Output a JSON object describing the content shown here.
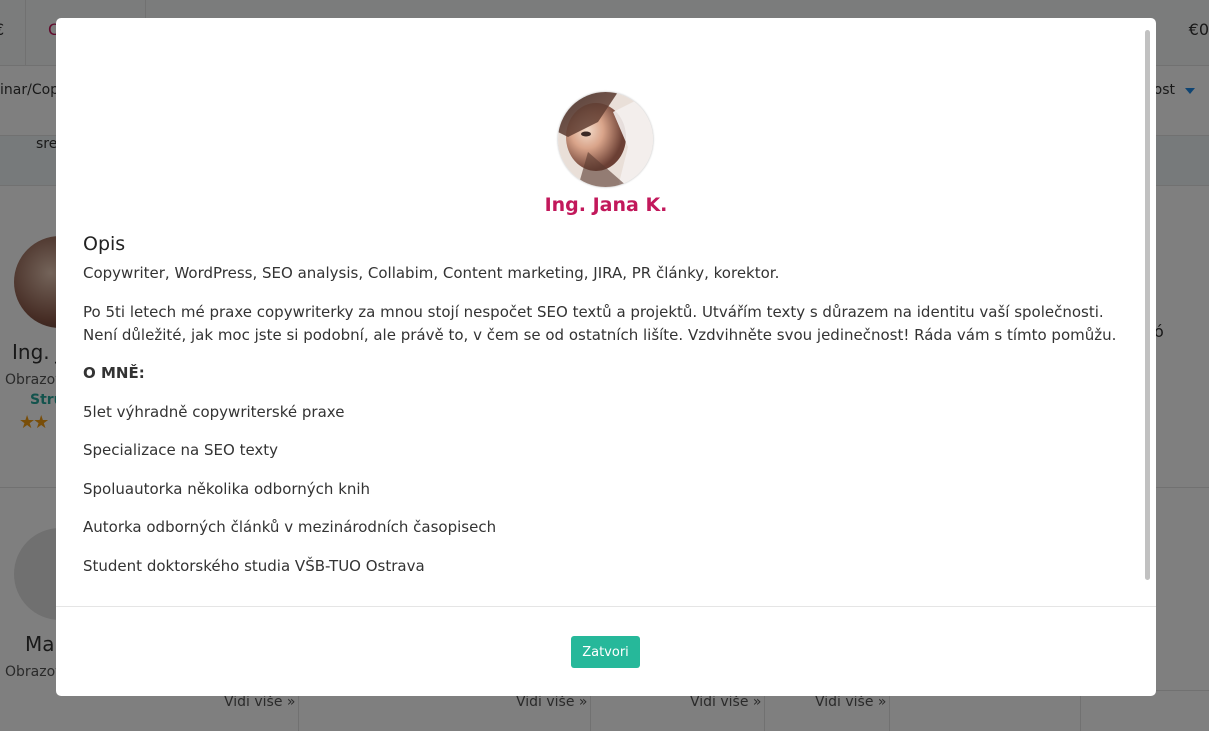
{
  "background": {
    "topbar": {
      "left_fragment": "€",
      "mid_fragment": "C",
      "right_fragment": "€0"
    },
    "filter": {
      "left_fragment": "inar/Cop",
      "right_fragment": "nost"
    },
    "strip": {
      "fragment": "sre"
    },
    "card1": {
      "name_fragment": "Ing. J",
      "sub_fragment": "Obrazov",
      "category_fragment": "Stru",
      "stars": "★★",
      "right_fragment": "ó"
    },
    "card2": {
      "name_fragment": "Ma",
      "sub_fragment": "Obrazov"
    },
    "more_links": [
      "Vidi više »",
      "Vidi više »",
      "Vidi više »",
      "Vidi više »"
    ]
  },
  "modal": {
    "name": "Ing. Jana K.",
    "section_title": "Opis",
    "skills": "Copywriter, WordPress, SEO analysis, Collabim, Content marketing, JIRA, PR články, korektor.",
    "intro": "Po 5ti letech mé praxe copywriterky za mnou stojí nespočet SEO textů a projektů. Utvářím texty s důrazem na identitu vaší společnosti. Není důležité, jak moc jste si podobní, ale právě to, v čem se od ostatních lišíte. Vzdvihněte svou jedinečnost! Ráda vám s tímto pomůžu.",
    "about_heading": "O MNĚ:",
    "about_items": [
      "5let výhradně copywriterské praxe",
      "Specializace na SEO texty",
      "Spoluautorka několika odborných knih",
      "Autorka odborných článků v mezinárodních časopisech",
      "Student doktorského studia VŠB-TUO Ostrava"
    ],
    "close_label": "Zatvori"
  },
  "colors": {
    "accent_name": "#c2185b",
    "button": "#26b89a"
  }
}
